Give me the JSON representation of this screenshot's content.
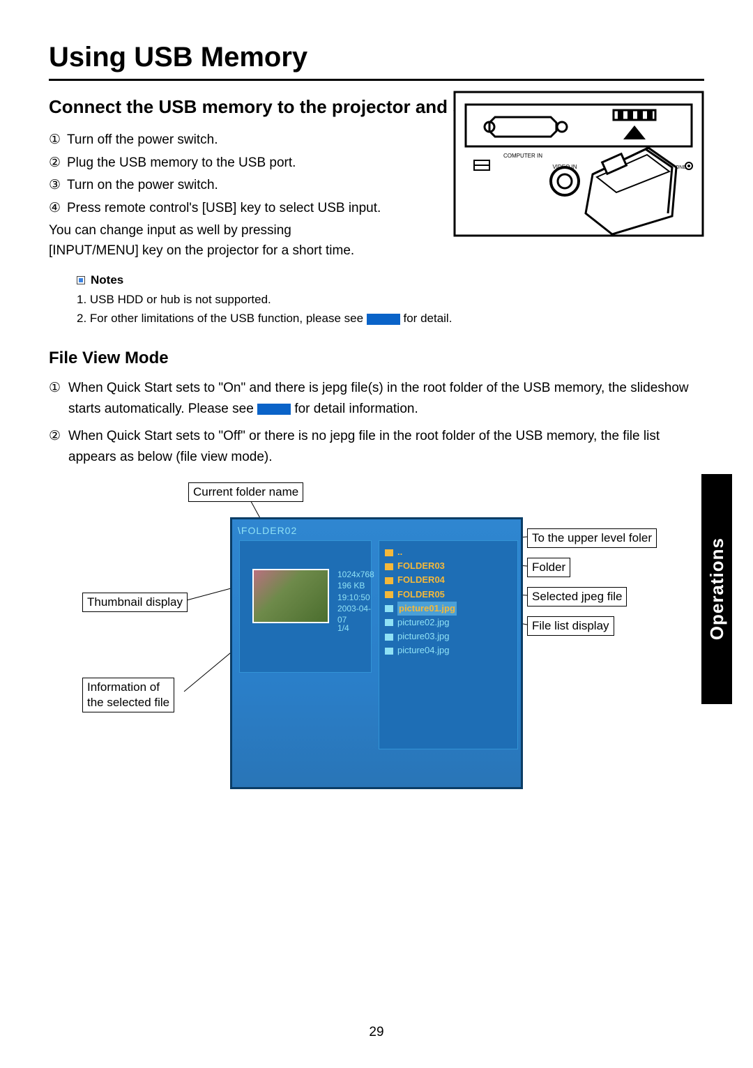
{
  "page": {
    "title": "Using USB Memory",
    "pageNumber": "29",
    "sideTab": "Operations"
  },
  "section1": {
    "heading": "Connect the USB memory to the projector and select USB input",
    "steps": [
      "Turn off the power switch.",
      "Plug the USB memory to the USB port.",
      "Turn on the power switch.",
      "Press remote control's [USB] key to select USB input."
    ],
    "numerals": [
      "①",
      "②",
      "③",
      "④"
    ],
    "paragraph": "You can change input as well by pressing [INPUT/MENU] key on the projector for a short time.",
    "projectorLabels": {
      "computerIn": "COMPUTER IN",
      "videoIn": "VIDEO IN",
      "phone": "\\DPHONE"
    }
  },
  "notes": {
    "heading": "Notes",
    "items": [
      "USB HDD or hub is not supported.",
      {
        "pre": "For other limitations of the USB function, please see ",
        "post": " for detail."
      }
    ]
  },
  "section2": {
    "heading": "File View Mode",
    "numerals": [
      "①",
      "②"
    ],
    "items": [
      {
        "pre": "When Quick Start sets to \"On\" and there is jepg file(s) in the root folder of the USB memory, the slideshow starts automatically. Please see ",
        "post": " for detail information."
      },
      "When Quick Start sets to \"Off\" or there is no jepg file in the root folder of the USB memory, the file list appears as below (file view mode)."
    ]
  },
  "diagram": {
    "path": "\\FOLDER02",
    "meta": [
      "1024x768",
      "196 KB",
      "19:10:50",
      "2003-04-07"
    ],
    "counter": "1/4",
    "list": {
      "up": "..",
      "folders": [
        "FOLDER03",
        "FOLDER04",
        "FOLDER05"
      ],
      "selected": "picture01.jpg",
      "files": [
        "picture02.jpg",
        "picture03.jpg",
        "picture04.jpg"
      ]
    },
    "labels": {
      "currentFolder": "Current folder name",
      "thumbnail": "Thumbnail display",
      "info": "Information of\nthe selected file",
      "upper": "To the upper level foler",
      "folder": "Folder",
      "selected": "Selected jpeg file",
      "fileList": "File list display"
    }
  }
}
